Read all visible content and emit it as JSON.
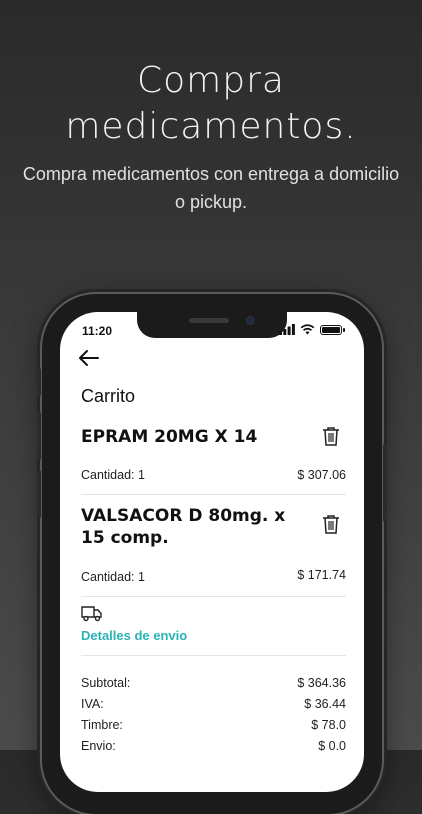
{
  "hero": {
    "title_line1": "Compra",
    "title_line2": "medicamentos.",
    "subtitle": "Compra medicamentos con entrega a domicilio o pickup."
  },
  "status_bar": {
    "time": "11:20"
  },
  "header": {
    "back_icon": "arrow-left-icon"
  },
  "cart": {
    "title": "Carrito",
    "items": [
      {
        "name": "EPRAM 20MG X 14",
        "quantity_label": "Cantidad: 1",
        "price": "$ 307.06"
      },
      {
        "name": "VALSACOR D 80mg. x 15 comp.",
        "quantity_label": "Cantidad: 1",
        "price": "$ 171.74"
      }
    ],
    "shipping": {
      "icon": "truck-icon",
      "link_label": "Detalles de envio"
    },
    "summary": [
      {
        "label": "Subtotal:",
        "value": "$ 364.36"
      },
      {
        "label": "IVA:",
        "value": "$ 36.44"
      },
      {
        "label": "Timbre:",
        "value": "$ 78.0"
      },
      {
        "label": "Envio:",
        "value": "$ 0.0"
      }
    ]
  },
  "colors": {
    "accent": "#29b3b6",
    "background": "#333333",
    "screen": "#ffffff"
  }
}
